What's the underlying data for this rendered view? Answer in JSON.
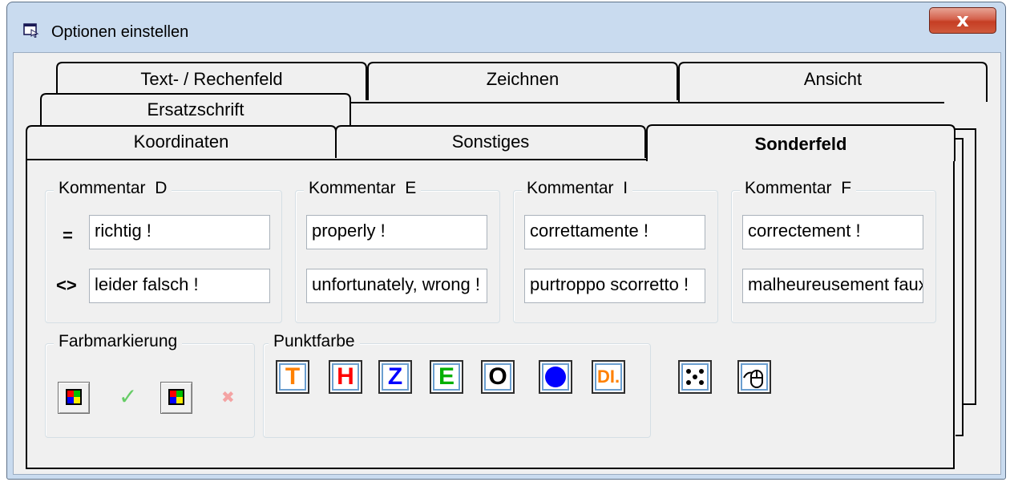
{
  "window": {
    "title": "Optionen einstellen",
    "close_glyph": "x"
  },
  "tabs": {
    "row1": [
      "Text- / Rechenfeld",
      "Zeichnen",
      "Ansicht"
    ],
    "row2": [
      "Ersatzschrift"
    ],
    "row3": [
      "Koordinaten",
      "Sonstiges",
      "Sonderfeld"
    ],
    "active": "Sonderfeld"
  },
  "comments": [
    {
      "title": "Kommentar  D",
      "correct": "richtig !",
      "wrong": "leider falsch !"
    },
    {
      "title": "Kommentar  E",
      "correct": "properly !",
      "wrong": "unfortunately, wrong !"
    },
    {
      "title": "Kommentar  I",
      "correct": "correttamente !",
      "wrong": "purtroppo scorretto !"
    },
    {
      "title": "Kommentar  F",
      "correct": "correctement !",
      "wrong": "malheureusement faux !"
    }
  ],
  "symbols": {
    "equal": "=",
    "not_equal": "<>"
  },
  "farbmarkierung": {
    "title": "Farbmarkierung",
    "check_glyph": "✓",
    "cross_glyph": "✖",
    "check_color": "#66cc66",
    "cross_color": "#f4a3a3"
  },
  "punktfarbe": {
    "title": "Punktfarbe",
    "buttons": [
      {
        "label": "T",
        "color": "#ff8000"
      },
      {
        "label": "H",
        "color": "#ff0000"
      },
      {
        "label": "Z",
        "color": "#0000ff"
      },
      {
        "label": "E",
        "color": "#00b000"
      },
      {
        "label": "O",
        "color": "#000000"
      },
      {
        "label": "",
        "color": "#0000ff",
        "icon": "filled-circle-icon"
      },
      {
        "label": "DI.",
        "color": "#ff8000",
        "icon": "dot-decimal-icon"
      }
    ]
  },
  "extra_buttons": [
    {
      "icon": "dots-pattern-icon"
    },
    {
      "icon": "mouse-cursor-icon"
    }
  ]
}
